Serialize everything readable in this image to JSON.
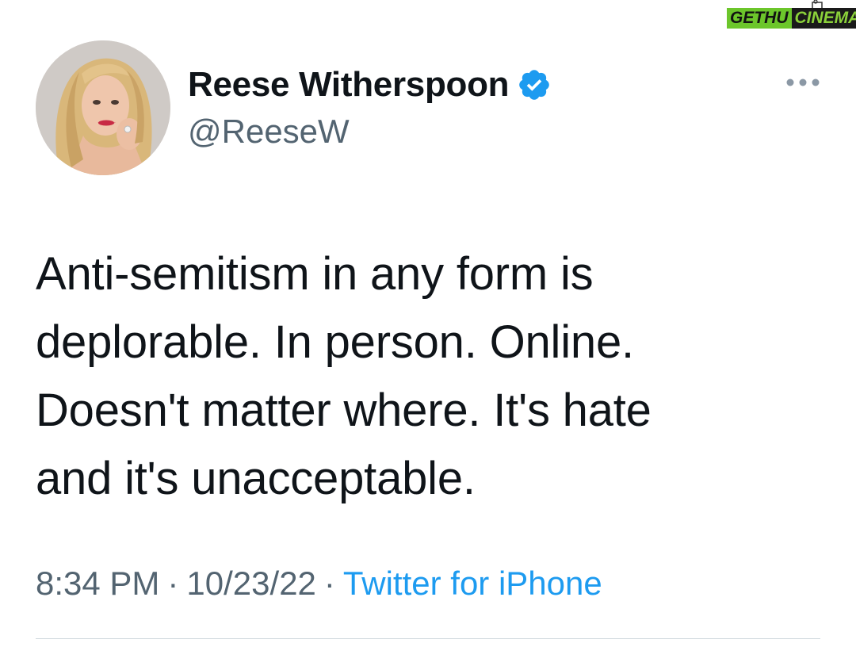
{
  "tweet": {
    "display_name": "Reese Witherspoon",
    "handle": "@ReeseW",
    "verified_icon": "verified-badge-icon",
    "more_icon": "more-options-icon",
    "text": "Anti-semitism in any form is\ndeplorable. In person. Online.\nDoesn't matter where. It's hate\nand it's unacceptable.",
    "time": "8:34 PM",
    "date": "10/23/22",
    "separator": "·",
    "source": "Twitter for iPhone"
  },
  "watermark": {
    "part1": "GETHU",
    "part2": "CINEMA"
  },
  "colors": {
    "verified_blue": "#1d9bf0",
    "text_primary": "#0f1419",
    "text_secondary": "#536471",
    "link": "#1d9bf0",
    "watermark_green": "#6cc62b"
  }
}
